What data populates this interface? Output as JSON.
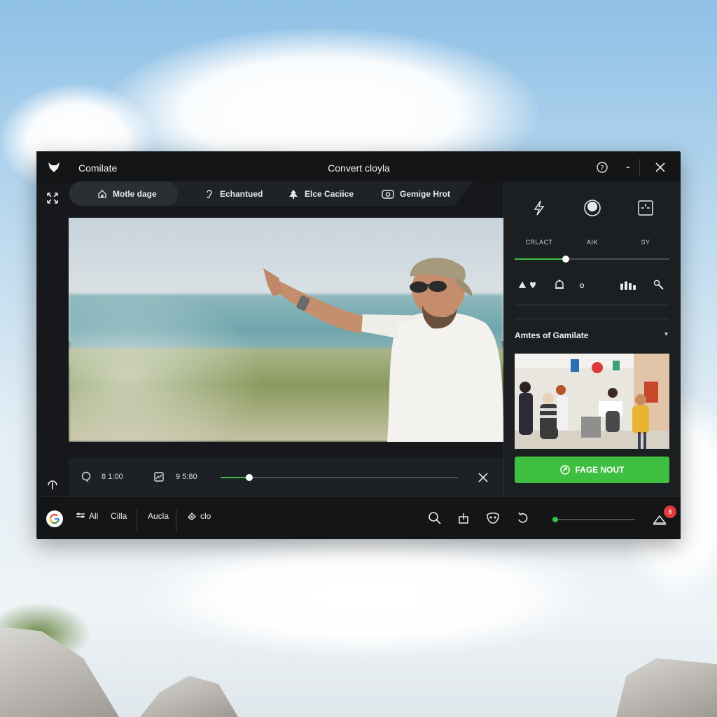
{
  "window": {
    "app_name": "Comilate",
    "title": "Convert cloyla"
  },
  "tabs": [
    {
      "label": "Motle dage",
      "icon": "home-icon",
      "active": true
    },
    {
      "label": "Echantued",
      "icon": "ear-icon",
      "active": false
    },
    {
      "label": "Elce Caciice",
      "icon": "tree-icon",
      "active": false
    },
    {
      "label": "Gemige Hrot",
      "icon": "camera-icon",
      "active": false
    }
  ],
  "timeline": {
    "time_left": "8 1:00",
    "time_right": "9 5:80",
    "progress": 0.12
  },
  "side_panel": {
    "tools": [
      {
        "label": "CRLACT",
        "icon": "lightning-icon"
      },
      {
        "label": "AIK",
        "icon": "orb-icon"
      },
      {
        "label": "SY",
        "icon": "grid-icon"
      }
    ],
    "slider_value": 0.33,
    "section_title": "Amtes of Gamilate",
    "export_label": "FAGE NOUT"
  },
  "bottom_bar": {
    "items": [
      {
        "label": "All",
        "icon": "filter-icon"
      },
      {
        "label": "Cilla"
      },
      {
        "label": "Aucla"
      },
      {
        "label": "clo",
        "icon": "droplet-icon"
      }
    ],
    "badge_count": "8"
  },
  "colors": {
    "accent": "#3fbf3f",
    "window_bg": "#16181b",
    "badge": "#e0393c"
  }
}
